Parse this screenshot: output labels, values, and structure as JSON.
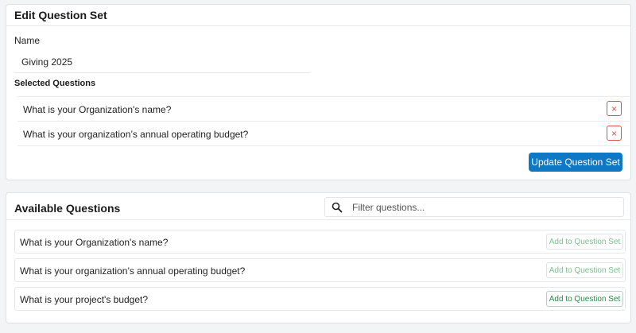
{
  "edit": {
    "title": "Edit Question Set",
    "name_label": "Name",
    "name_value": "Giving 2025",
    "selected_title": "Selected Questions",
    "selected": [
      {
        "text": "What is your Organization's name?",
        "remove": "×"
      },
      {
        "text": "What is your organization’s annual operating budget?",
        "remove": "×"
      }
    ],
    "update_label": "Update Question Set"
  },
  "available": {
    "title": "Available Questions",
    "filter_placeholder": "Filter questions...",
    "search_icon": "search-icon",
    "items": [
      {
        "text": "What is your Organization's name?",
        "button": "Add to Question Set",
        "disabled": true
      },
      {
        "text": "What is your organization’s annual operating budget?",
        "button": "Add to Question Set",
        "disabled": true
      },
      {
        "text": "What is your project's budget?",
        "button": "Add to Question Set",
        "disabled": false
      }
    ]
  },
  "colors": {
    "primary": "#0e78c4",
    "danger": "#d9534f",
    "success": "#2b8a47",
    "success_muted": "#7dbf8f"
  }
}
